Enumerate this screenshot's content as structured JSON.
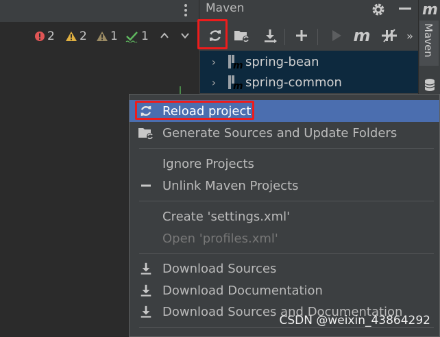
{
  "colors": {
    "accent": "#4b6eaf",
    "highlight_box": "#ee1c1c",
    "maven_blue": "#4fa3d9",
    "error": "#e05555",
    "warning": "#e0b040",
    "ok": "#5fb85f"
  },
  "editor": {
    "inspections": {
      "errors": "2",
      "warnings": "2",
      "weak_warnings": "1",
      "typos": "1"
    }
  },
  "maven": {
    "title": "Maven",
    "side_tab_label": "Maven",
    "toolbar": {
      "icons": [
        "reload-icon",
        "generate-sources-icon",
        "download-icon",
        "add-icon",
        "run-icon",
        "maven-m-icon",
        "skip-tests-icon",
        "more-icon"
      ],
      "more_label": "»"
    },
    "tree": [
      {
        "label": "spring-bean"
      },
      {
        "label": "spring-common"
      }
    ]
  },
  "context_menu": {
    "items": [
      {
        "label": "Reload project",
        "icon": "reload-icon",
        "selected": true
      },
      {
        "label": "Generate Sources and Update Folders",
        "icon": "generate-sources-icon"
      },
      {
        "label": "Ignore Projects"
      },
      {
        "label": "Unlink Maven Projects",
        "icon": "minus-icon"
      },
      {
        "label": "Create 'settings.xml'"
      },
      {
        "label": "Open 'profiles.xml'",
        "disabled": true
      },
      {
        "label": "Download Sources",
        "icon": "download-icon"
      },
      {
        "label": "Download Documentation",
        "icon": "download-icon"
      },
      {
        "label": "Download Sources and Documentation",
        "icon": "download-icon"
      }
    ]
  },
  "watermark": "CSDN @weixin_43864292"
}
